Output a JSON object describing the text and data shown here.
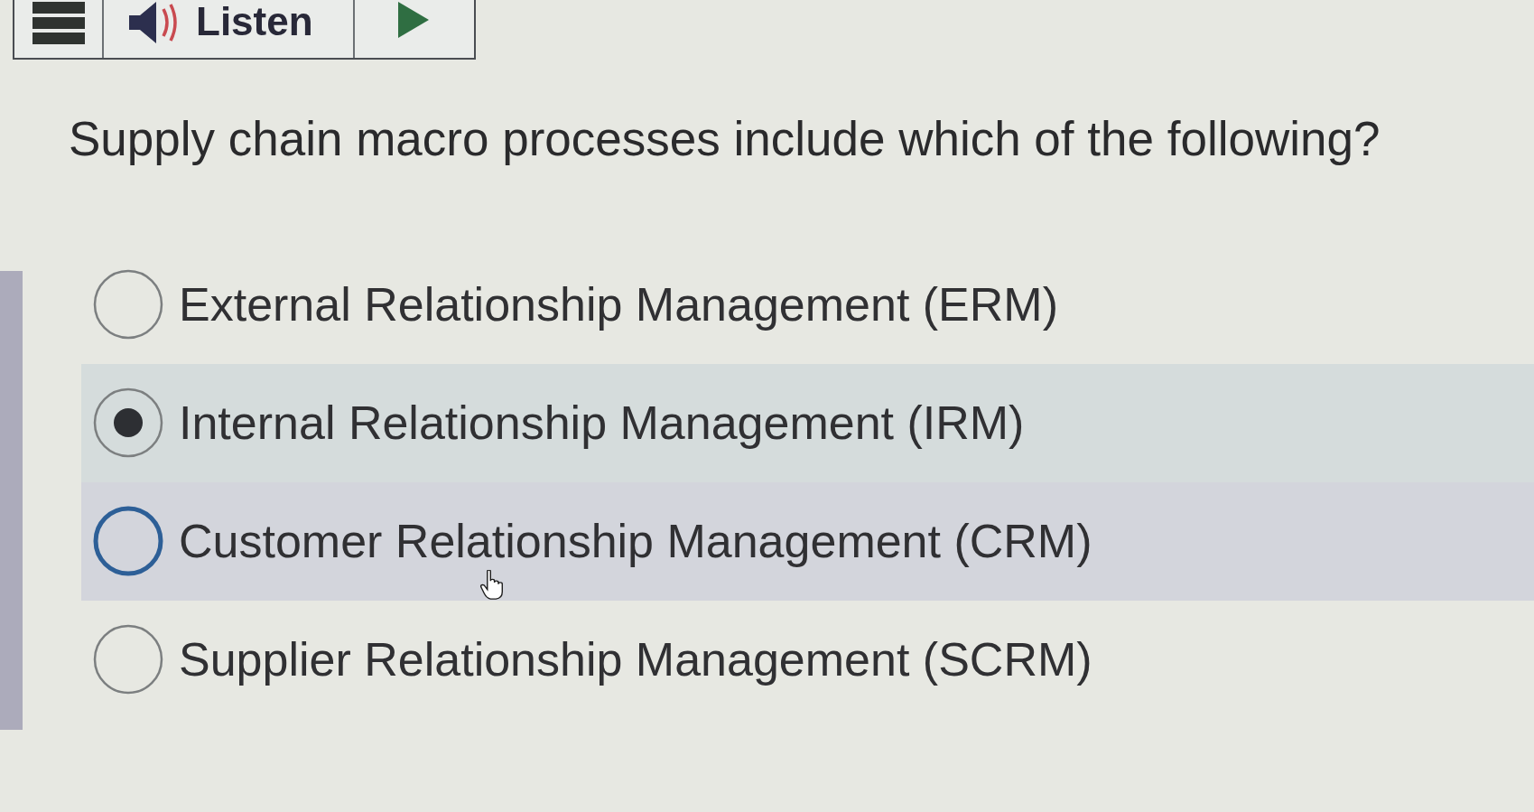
{
  "toolbar": {
    "listen_label": "Listen"
  },
  "question": "Supply chain macro processes include which of the following?",
  "options": [
    {
      "label": "External Relationship Management (ERM)",
      "selected": false,
      "hovered": false
    },
    {
      "label": "Internal Relationship Management (IRM)",
      "selected": true,
      "hovered": false
    },
    {
      "label": "Customer Relationship Management (CRM)",
      "selected": false,
      "hovered": true
    },
    {
      "label": "Supplier Relationship Management (SCRM)",
      "selected": false,
      "hovered": false
    }
  ]
}
